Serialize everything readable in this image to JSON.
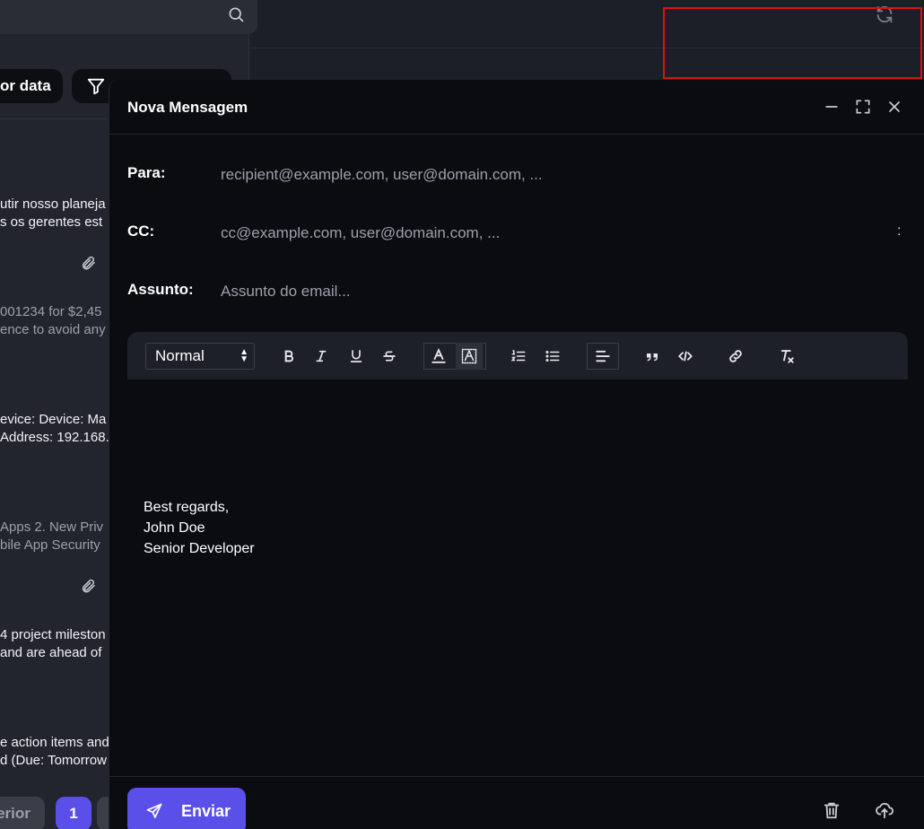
{
  "background": {
    "sort_button_label": "or data",
    "snippets": [
      {
        "line1": "utir nosso planeja",
        "line2": "s os gerentes est",
        "tone": "bright",
        "attachment": true
      },
      {
        "line1": "001234 for $2,45",
        "line2": "ence to avoid any",
        "tone": "dim",
        "attachment": false
      },
      {
        "line1": "evice: Device: Ma",
        "line2": "Address: 192.168.:",
        "tone": "bright",
        "attachment": false
      },
      {
        "line1": "Apps 2. New Priv",
        "line2": "bile App Security",
        "tone": "dim",
        "attachment": true
      },
      {
        "line1": "4 project mileston",
        "line2": " and are ahead of",
        "tone": "bright",
        "attachment": false
      },
      {
        "line1": "e action items and",
        "line2": "d (Due: Tomorrow",
        "tone": "bright",
        "attachment": false
      }
    ],
    "pagination": {
      "prev_label": "erior",
      "current_page": "1"
    }
  },
  "compose": {
    "title": "Nova Mensagem",
    "to_label": "Para:",
    "to_placeholder": "recipient@example.com, user@domain.com, ...",
    "cc_label": "CC:",
    "cc_placeholder": "cc@example.com, user@domain.com, ...",
    "cc_more": ":",
    "subject_label": "Assunto:",
    "subject_placeholder": "Assunto do email...",
    "format_select": "Normal",
    "signature": [
      "Best regards,",
      "John Doe",
      "Senior Developer"
    ],
    "send_label": "Enviar"
  },
  "icons": {
    "search": "search-icon",
    "refresh": "refresh-icon",
    "filter": "filter-icon",
    "paperclip": "paperclip-icon",
    "minimize": "minimize-icon",
    "maximize": "maximize-icon",
    "close": "close-icon",
    "send": "send-icon",
    "trash": "trash-icon",
    "upload": "cloud-upload-icon"
  },
  "colors": {
    "accent": "#5b4fea",
    "modal_bg": "#0b0c10",
    "highlight": "#e01010"
  }
}
